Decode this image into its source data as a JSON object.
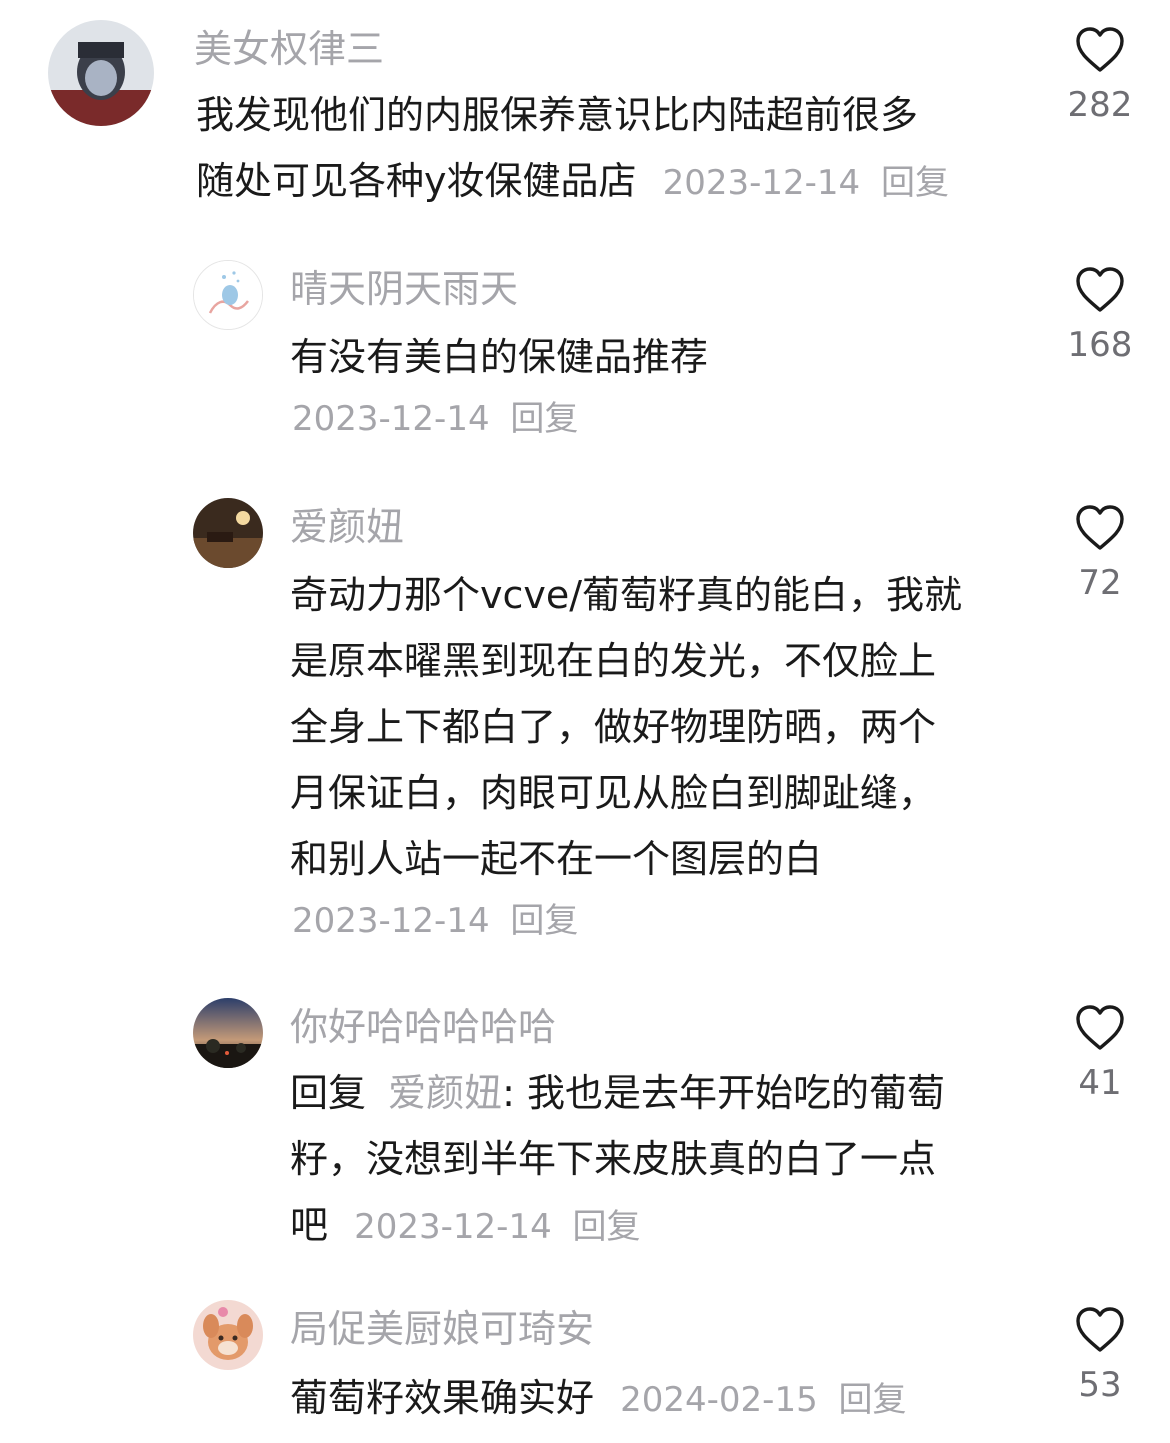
{
  "comments": [
    {
      "username": "美女权律三",
      "text": "我发现他们的内服保养意识比内陆超前很多随处可见各种y妆保健品店",
      "line1": "我发现他们的内服保养意识比内陆超前很多",
      "line2": "随处可见各种y妆保健品店",
      "date": "2023-12-14",
      "reply_label": "回复",
      "likes": "282",
      "avatar_icon": "user-avatar-icon"
    },
    {
      "username": "晴天阴天雨天",
      "text": "有没有美白的保健品推荐",
      "date": "2023-12-14",
      "reply_label": "回复",
      "likes": "168",
      "avatar_icon": "user-avatar-icon"
    },
    {
      "username": "爱颜妞",
      "lines": [
        "奇动力那个vcve/葡萄籽真的能白，我就",
        "是原本曜黑到现在白的发光，不仅脸上",
        "全身上下都白了，做好物理防晒，两个",
        "月保证白，肉眼可见从脸白到脚趾缝，",
        "和别人站一起不在一个图层的白"
      ],
      "date": "2023-12-14",
      "reply_label": "回复",
      "likes": "72",
      "avatar_icon": "user-avatar-icon"
    },
    {
      "username": "你好哈哈哈哈哈",
      "reply_prefix": "回复",
      "reply_target": "爱颜妞",
      "line1": ": 我也是去年开始吃的葡萄",
      "line2": "籽，没想到半年下来皮肤真的白了一点",
      "line3": "吧",
      "date": "2023-12-14",
      "reply_label": "回复",
      "likes": "41",
      "avatar_icon": "user-avatar-icon"
    },
    {
      "username": "局促美厨娘可琦安",
      "text": "葡萄籽效果确实好",
      "date": "2024-02-15",
      "reply_label": "回复",
      "likes": "53",
      "avatar_icon": "user-avatar-icon"
    }
  ],
  "colors": {
    "text": "#1a1a1a",
    "muted": "#a5a5aa",
    "background": "#ffffff"
  }
}
